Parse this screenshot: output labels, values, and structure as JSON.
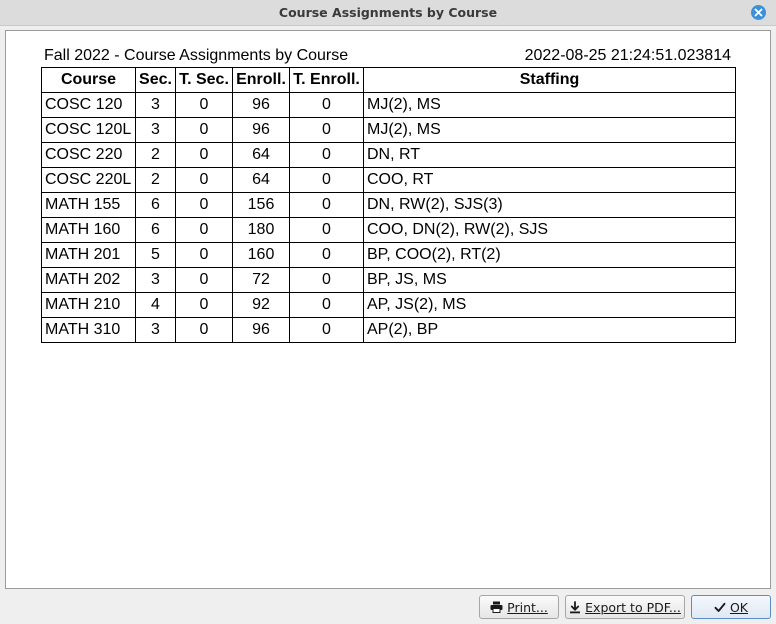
{
  "window": {
    "title": "Course Assignments by Course"
  },
  "report": {
    "title": "Fall 2022 - Course Assignments by Course",
    "timestamp": "2022-08-25 21:24:51.023814",
    "columns": [
      "Course",
      "Sec.",
      "T. Sec.",
      "Enroll.",
      "T. Enroll.",
      "Staffing"
    ],
    "rows": [
      [
        "COSC 120",
        "3",
        "0",
        "96",
        "0",
        "MJ(2), MS"
      ],
      [
        "COSC 120L",
        "3",
        "0",
        "96",
        "0",
        "MJ(2), MS"
      ],
      [
        "COSC 220",
        "2",
        "0",
        "64",
        "0",
        "DN, RT"
      ],
      [
        "COSC 220L",
        "2",
        "0",
        "64",
        "0",
        "COO, RT"
      ],
      [
        "MATH 155",
        "6",
        "0",
        "156",
        "0",
        "DN, RW(2), SJS(3)"
      ],
      [
        "MATH 160",
        "6",
        "0",
        "180",
        "0",
        "COO, DN(2), RW(2), SJS"
      ],
      [
        "MATH 201",
        "5",
        "0",
        "160",
        "0",
        "BP, COO(2), RT(2)"
      ],
      [
        "MATH 202",
        "3",
        "0",
        "72",
        "0",
        "BP, JS, MS"
      ],
      [
        "MATH 210",
        "4",
        "0",
        "92",
        "0",
        "AP, JS(2), MS"
      ],
      [
        "MATH 310",
        "3",
        "0",
        "96",
        "0",
        "AP(2), BP"
      ]
    ]
  },
  "buttons": {
    "print": {
      "label": "Print...",
      "icon": "printer-icon"
    },
    "export": {
      "label": "Export to PDF...",
      "icon": "download-icon"
    },
    "ok": {
      "label": "OK",
      "icon": "checkmark-icon"
    }
  },
  "colors": {
    "close_button": "#3e8fd6",
    "titlebar": "#dcdcdc",
    "ok_border": "#5d8cc4"
  }
}
